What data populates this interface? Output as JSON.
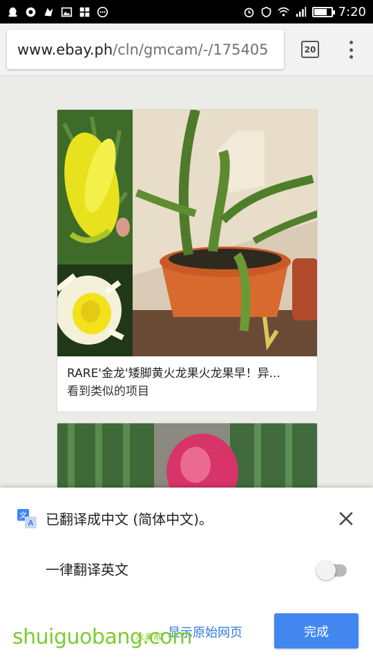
{
  "status_bar": {
    "time": "7:20"
  },
  "browser": {
    "url_host": "www.ebay.ph",
    "url_path": "/cln/gmcam/-/175405",
    "tab_count": "20"
  },
  "listings": [
    {
      "title": "RARE'金龙'矮脚黄火龙果火龙果早！异...",
      "subtitle": "看到类似的项目"
    }
  ],
  "translate_bar": {
    "message": "已翻译成中文 (简体中文)。",
    "option_label": "一律翻译英文",
    "option_on": false,
    "show_original_label": "显示原始网页",
    "done_label": "完成"
  },
  "watermark": {
    "text": "shuiguobang.com",
    "small_text": "水果帮"
  },
  "colors": {
    "accent": "#4287f0",
    "link": "#2f7be0",
    "watermark": "#7ccc2e"
  }
}
